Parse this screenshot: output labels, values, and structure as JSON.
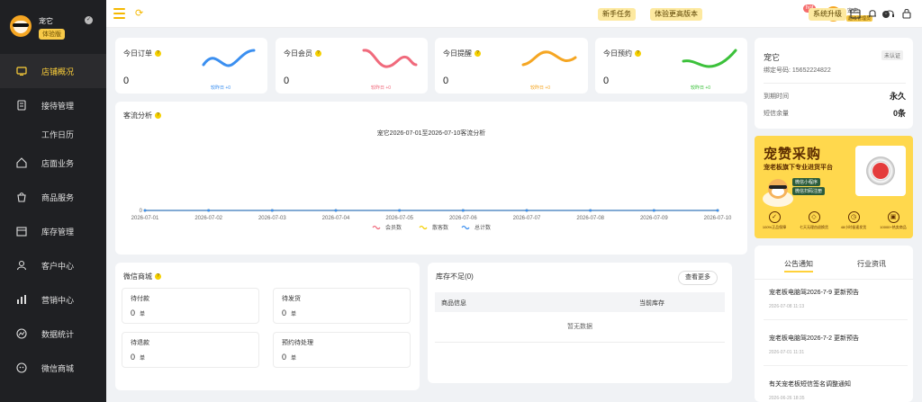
{
  "sidebar": {
    "user_name": "宠它",
    "badge": "体验版",
    "items": [
      {
        "label": "店铺概况",
        "icon": "dashboard-icon",
        "active": true
      },
      {
        "label": "接待管理",
        "icon": "reception-icon",
        "sub": "工作日历"
      },
      {
        "label": "店面业务",
        "icon": "store-icon"
      },
      {
        "label": "商品服务",
        "icon": "goods-icon"
      },
      {
        "label": "库存管理",
        "icon": "inventory-icon"
      },
      {
        "label": "客户中心",
        "icon": "customer-icon"
      },
      {
        "label": "营销中心",
        "icon": "marketing-icon"
      },
      {
        "label": "数据统计",
        "icon": "statistics-icon"
      },
      {
        "label": "微信商城",
        "icon": "wechat-icon"
      }
    ]
  },
  "topbar": {
    "btn_newbie": "新手任务",
    "btn_trial": "体验更高版本",
    "hot": "hot",
    "user_name": "宠它",
    "user_tag": "超级管理员",
    "btn_upgrade": "系统升级"
  },
  "stats": [
    {
      "title": "今日订单",
      "value": "0",
      "foot": "较昨日 +0",
      "color": "#3b8ff0"
    },
    {
      "title": "今日会员",
      "value": "0",
      "foot": "较昨日 +0",
      "color": "#f06a7c"
    },
    {
      "title": "今日提醒",
      "value": "0",
      "foot": "较昨日 +0",
      "color": "#f5a623"
    },
    {
      "title": "今日预约",
      "value": "0",
      "foot": "较昨日 +0",
      "color": "#3cc13b"
    }
  ],
  "traffic": {
    "title": "客流分析",
    "chart_data": {
      "type": "line",
      "title": "宠它2026-07-01至2026-07-10客流分析",
      "categories": [
        "2026-07-01",
        "2026-07-02",
        "2026-07-03",
        "2026-07-04",
        "2026-07-05",
        "2026-07-06",
        "2026-07-07",
        "2026-07-08",
        "2026-07-09",
        "2026-07-10"
      ],
      "y_tick": "0",
      "series": [
        {
          "name": "会员数",
          "color": "#f06a7c",
          "values": [
            0,
            0,
            0,
            0,
            0,
            0,
            0,
            0,
            0,
            0
          ]
        },
        {
          "name": "散客数",
          "color": "#f5d000",
          "values": [
            0,
            0,
            0,
            0,
            0,
            0,
            0,
            0,
            0,
            0
          ]
        },
        {
          "name": "总计数",
          "color": "#3b8ff0",
          "values": [
            0,
            0,
            0,
            0,
            0,
            0,
            0,
            0,
            0,
            0
          ]
        }
      ],
      "legend": "bottom"
    }
  },
  "wechat": {
    "title": "微信商城",
    "boxes": [
      {
        "label": "待付款",
        "value": "0",
        "unit": "单"
      },
      {
        "label": "待发货",
        "value": "0",
        "unit": "单"
      },
      {
        "label": "待退款",
        "value": "0",
        "unit": "单"
      },
      {
        "label": "预约待处理",
        "value": "0",
        "unit": "单"
      }
    ]
  },
  "stock": {
    "title": "库存不足(0)",
    "more": "查看更多",
    "col_product": "商品信息",
    "col_stock": "当前库存",
    "empty": "暂无数据"
  },
  "account": {
    "name": "宠它",
    "badge": "未认证",
    "phone": "绑定号码: 15652224822",
    "expire_label": "到期时间",
    "expire_value": "永久",
    "sms_label": "短信余量",
    "sms_value": "0条"
  },
  "banner": {
    "title": "宠赞采购",
    "subtitle": "宠老板旗下专业进货平台",
    "chip1": "微信小程序",
    "chip2": "微信扫码注册",
    "features": [
      "100%正品保障",
      "七天无理由退换货",
      "48小时极速发货",
      "10000+热卖商品"
    ]
  },
  "news": {
    "tab_notice": "公告通知",
    "tab_industry": "行业资讯",
    "items": [
      {
        "title": "宠老板电脑驾2026-7-9 更新预告",
        "date": "2026-07-08 11:13"
      },
      {
        "title": "宠老板电脑驾2026-7-2 更新预告",
        "date": "2026-07-01 11:31"
      },
      {
        "title": "有关宠老板短信签名调整通知",
        "date": "2026-06-26 18:35"
      }
    ]
  }
}
